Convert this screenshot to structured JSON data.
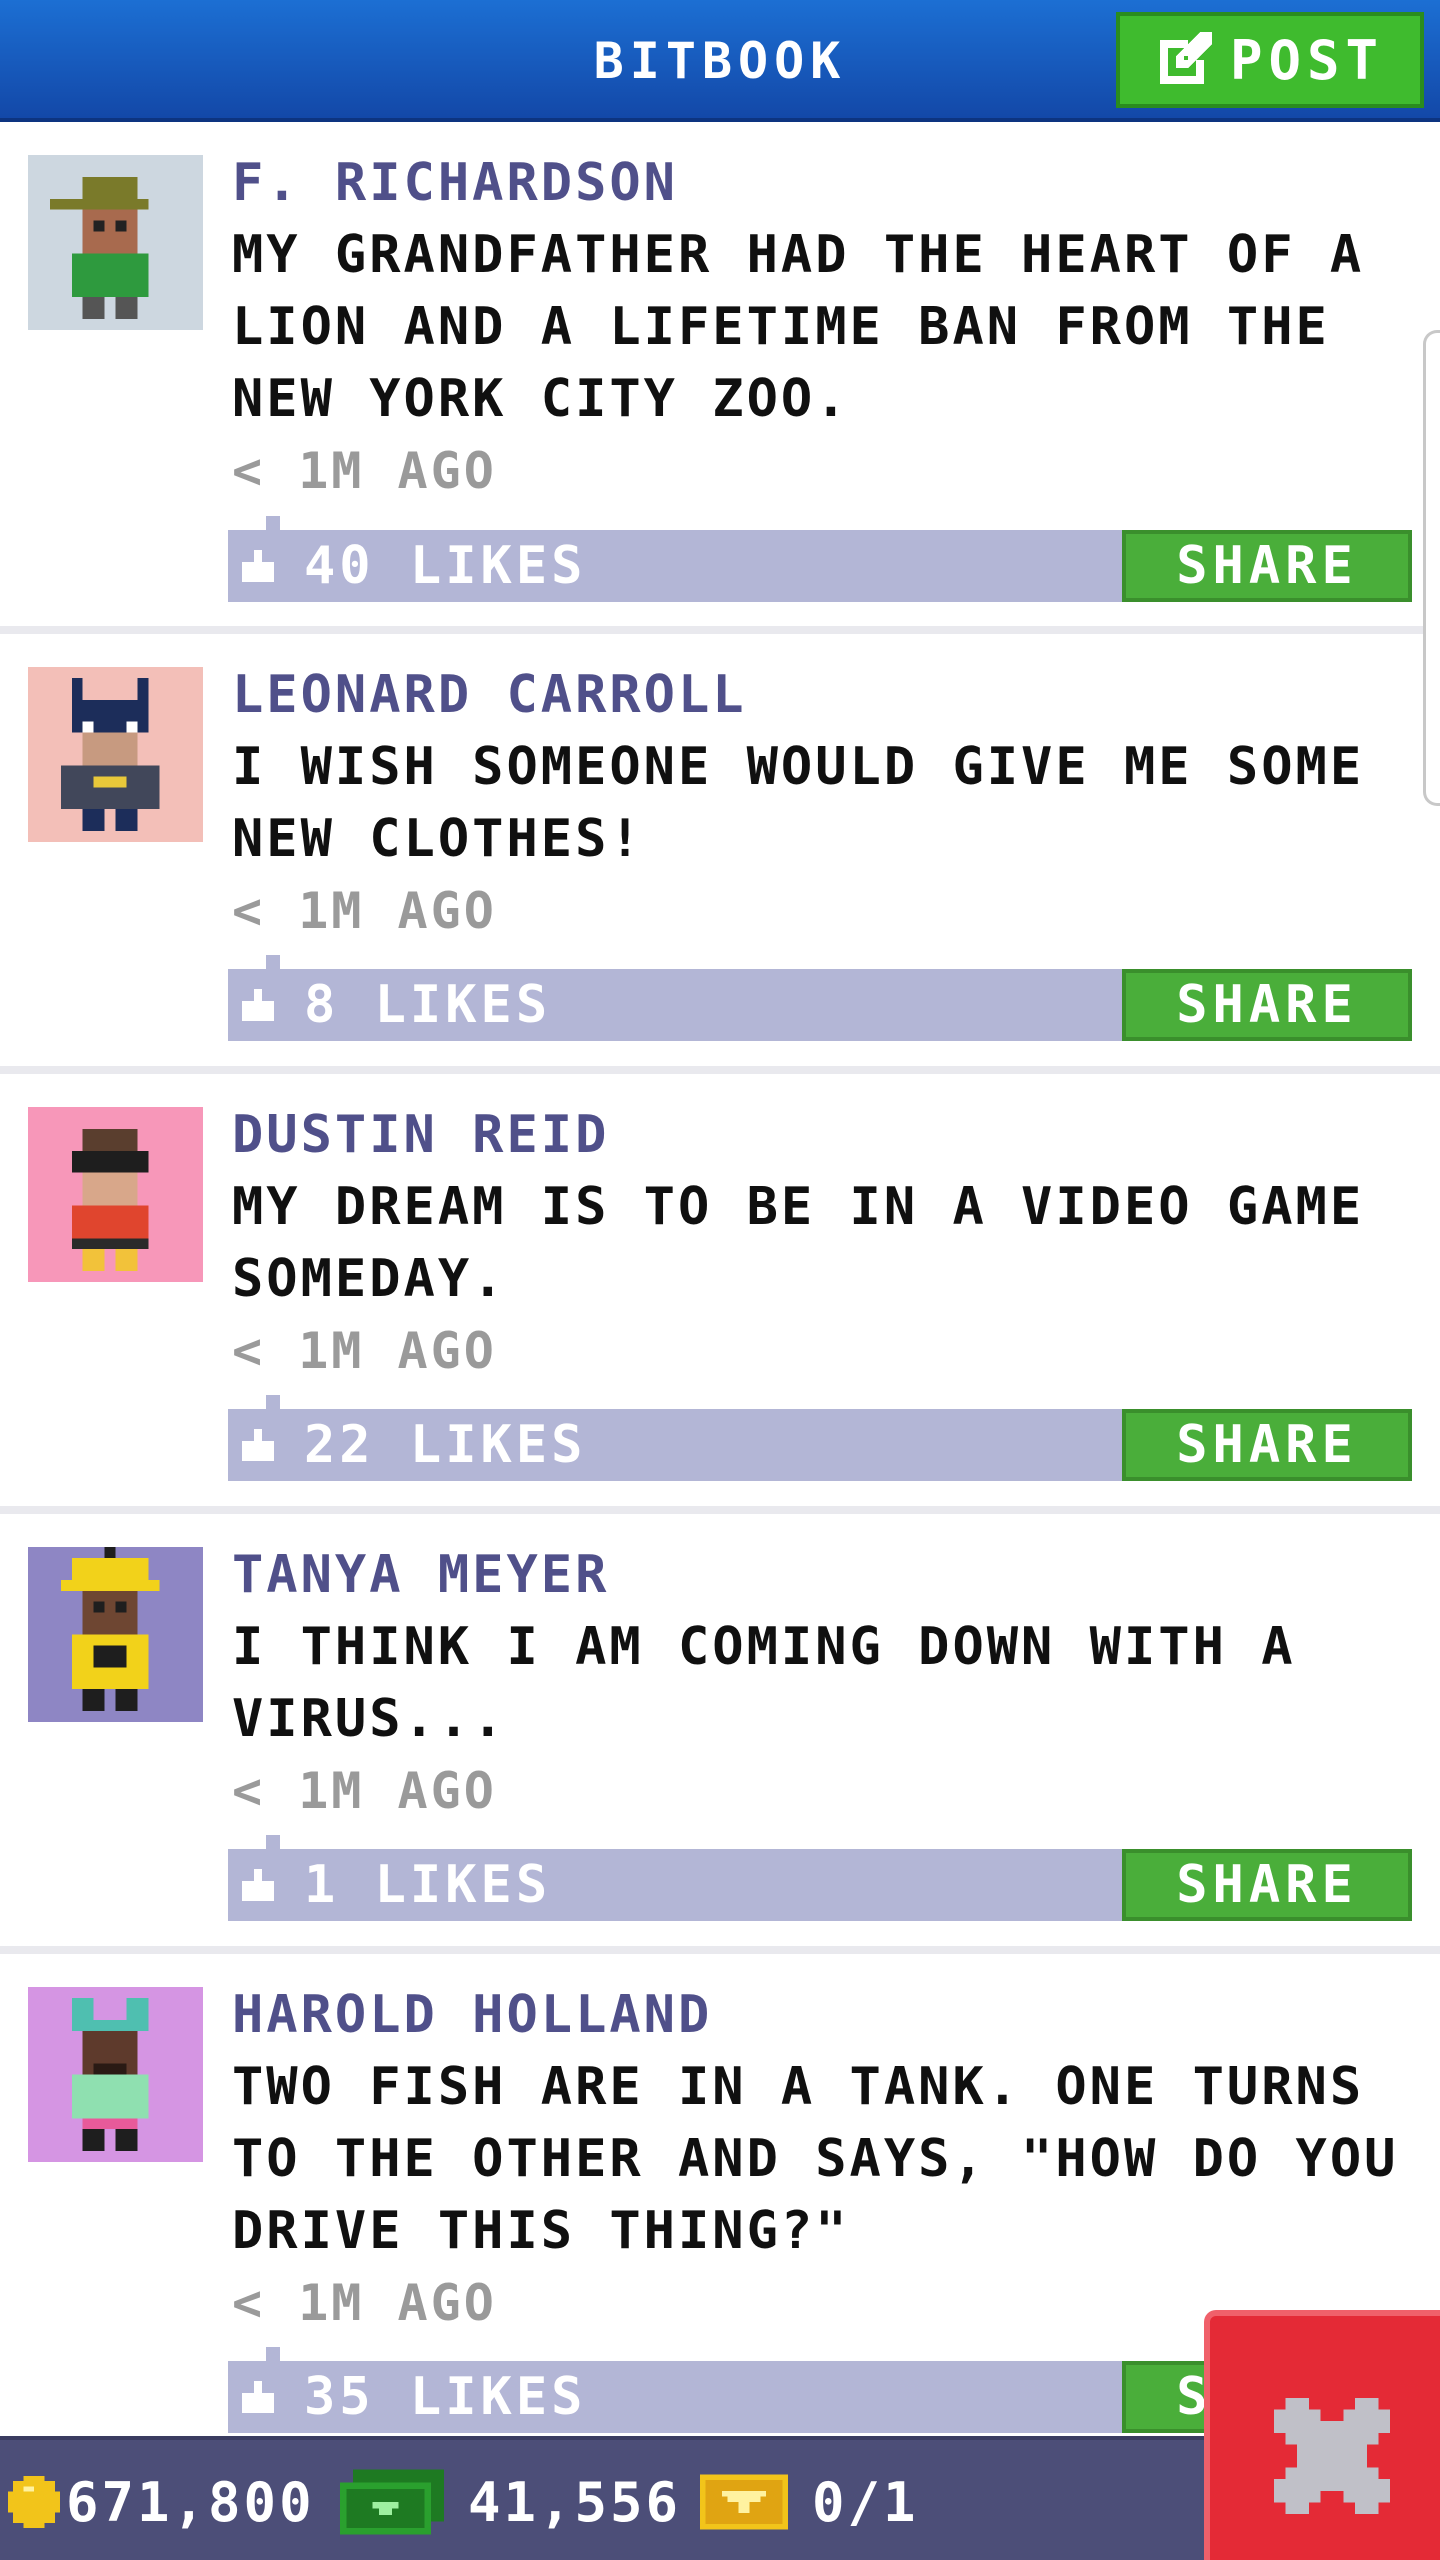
{
  "header": {
    "title": "BITBOOK",
    "post_label": "POST"
  },
  "posts": [
    {
      "author": "F. RICHARDSON",
      "message": "MY GRANDFATHER HAD THE HEART OF A LION AND A LIFETIME BAN FROM THE NEW YORK CITY ZOO.",
      "time": "< 1M AGO",
      "likes": "40 LIKES",
      "share_label": "SHARE",
      "avatar_bg": "#cdd7e0"
    },
    {
      "author": "LEONARD CARROLL",
      "message": "I WISH SOMEONE WOULD GIVE ME SOME NEW CLOTHES!",
      "time": "< 1M AGO",
      "likes": "8 LIKES",
      "share_label": "SHARE",
      "avatar_bg": "#f3bfb8"
    },
    {
      "author": "DUSTIN REID",
      "message": "MY DREAM IS TO BE IN A VIDEO GAME SOMEDAY.",
      "time": "< 1M AGO",
      "likes": "22 LIKES",
      "share_label": "SHARE",
      "avatar_bg": "#f797b9"
    },
    {
      "author": "TANYA MEYER",
      "message": "I THINK I AM COMING DOWN WITH A VIRUS...",
      "time": "< 1M AGO",
      "likes": "1 LIKES",
      "share_label": "SHARE",
      "avatar_bg": "#8e86c4"
    },
    {
      "author": "HAROLD HOLLAND",
      "message": "TWO FISH ARE IN A TANK. ONE TURNS TO THE OTHER AND SAYS, \"HOW DO YOU DRIVE THIS THING?\"",
      "time": "< 1M AGO",
      "likes": "35 LIKES",
      "share_label": "SHARE",
      "avatar_bg": "#d595e3"
    }
  ],
  "footer": {
    "coins": "671,800",
    "bux": "41,556",
    "vip": "0/1"
  },
  "colors": {
    "header_blue": "#1c6fd3",
    "accent_green": "#3fbb2e",
    "like_bar": "#b3b6d6",
    "author_purple": "#50508a",
    "footer": "#4c4e78",
    "close_red": "#e42a36"
  }
}
